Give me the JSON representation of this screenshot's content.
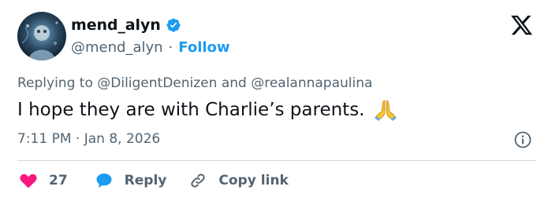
{
  "author": {
    "display_name": "mend_alyn",
    "handle": "@mend_alyn",
    "separator": "·",
    "follow_label": "Follow"
  },
  "reply_context": {
    "prefix": "Replying to",
    "mention_1": "@DiligentDenizen",
    "conjunction": "and",
    "mention_2": "@realannapaulina"
  },
  "tweet": {
    "text": "I hope they are with Charlie’s parents."
  },
  "meta": {
    "timestamp": "7:11 PM · Jan 8, 2026"
  },
  "actions": {
    "like_count": "27",
    "reply_label": "Reply",
    "copy_label": "Copy link"
  },
  "colors": {
    "accent": "#1d9bf0",
    "secondary_text": "#536471",
    "like_red": "#f91880",
    "divider": "#cfd9de"
  },
  "icons": {
    "platform_logo": "x-logo",
    "verified": "verified-badge-icon",
    "emoji": "folded-hands-icon",
    "info": "info-icon",
    "like": "heart-icon",
    "reply": "speech-bubble-icon",
    "copy": "link-icon"
  }
}
